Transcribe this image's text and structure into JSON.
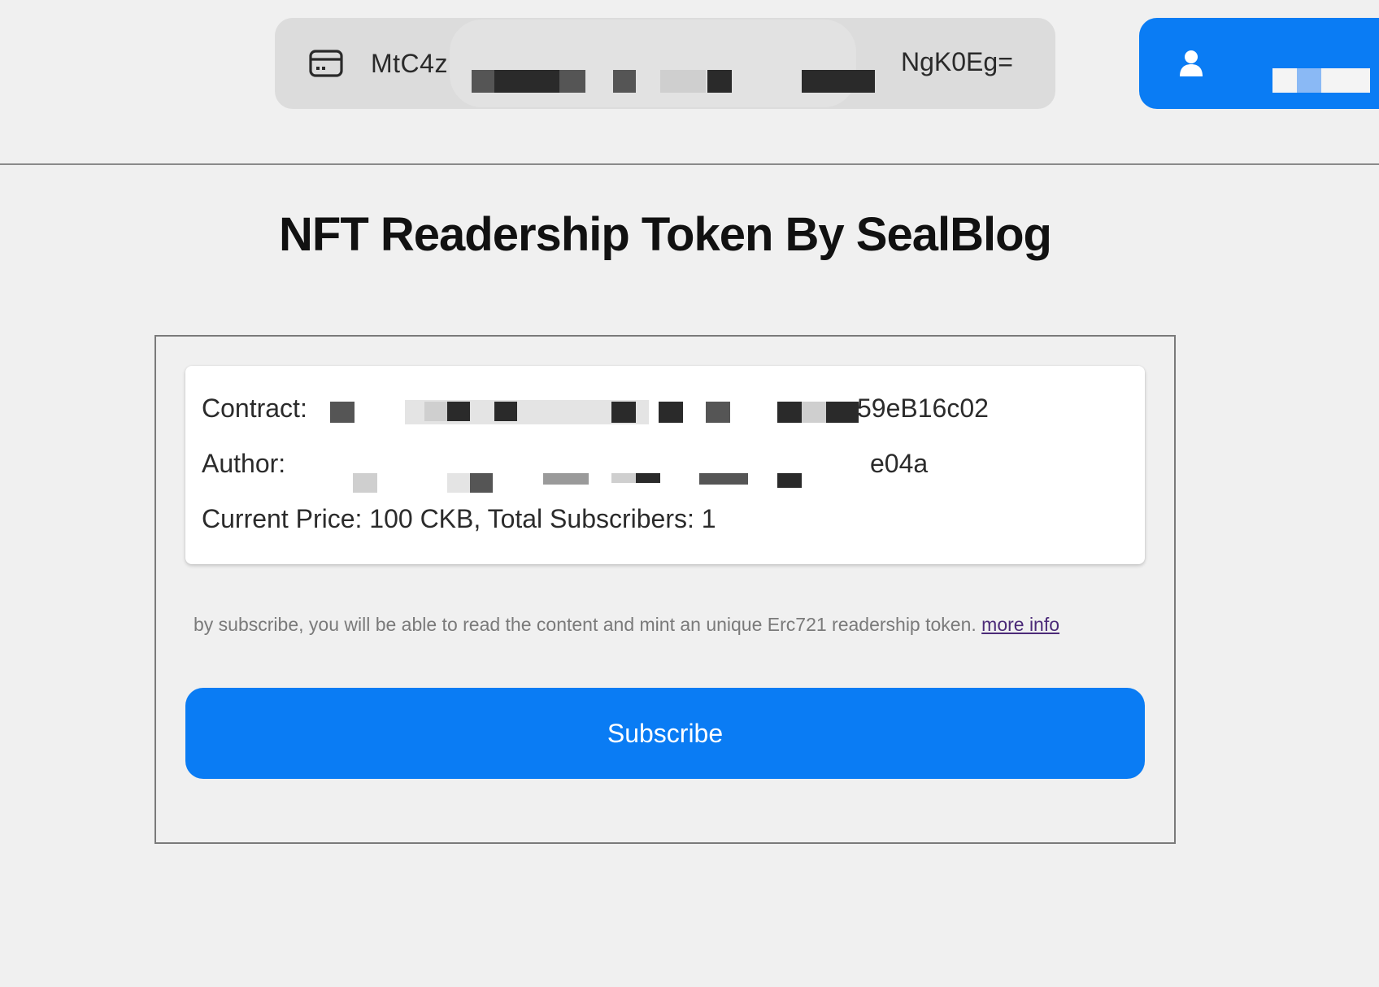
{
  "header": {
    "wallet_address_start": "MtC4z",
    "wallet_address_end": "NgK0Eg=",
    "wallet_icon": "credit-card-icon",
    "account_icon": "user-icon",
    "account_label": ""
  },
  "page": {
    "title": "NFT Readership Token By SealBlog"
  },
  "contract_info": {
    "contract_label": "Contract:",
    "contract_value_end": "59eB16c02",
    "author_label": "Author:",
    "author_value_end": "e04a",
    "price_line": "Current Price: 100 CKB, Total Subscribers: 1"
  },
  "subscribe": {
    "note_text": "by subscribe, you will be able to read the content and mint an unique Erc721 readership token.",
    "more_info_link": "more info",
    "button_label": "Subscribe"
  },
  "colors": {
    "accent": "#0a7cf4",
    "background": "#f0f0f0",
    "wallet_pill": "#dcdcdc",
    "link": "#4b2a78"
  }
}
